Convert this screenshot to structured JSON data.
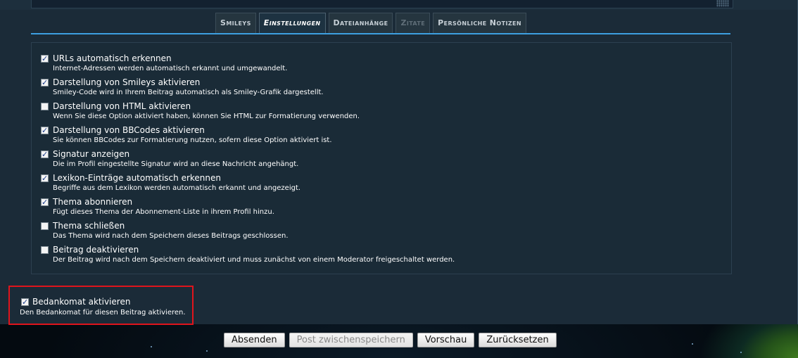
{
  "tabs": [
    {
      "label": "Smileys",
      "state": "normal"
    },
    {
      "label": "Einstellungen",
      "state": "active"
    },
    {
      "label": "Dateianhänge",
      "state": "normal"
    },
    {
      "label": "Zitate",
      "state": "disabled"
    },
    {
      "label": "Persönliche Notizen",
      "state": "normal"
    }
  ],
  "options": [
    {
      "label": "URLs automatisch erkennen",
      "desc": "Internet-Adressen werden automatisch erkannt und umgewandelt.",
      "checked": true
    },
    {
      "label": "Darstellung von Smileys aktivieren",
      "desc": "Smiley-Code wird in Ihrem Beitrag automatisch als Smiley-Grafik dargestellt.",
      "checked": true
    },
    {
      "label": "Darstellung von HTML aktivieren",
      "desc": "Wenn Sie diese Option aktiviert haben, können Sie HTML zur Formatierung verwenden.",
      "checked": false
    },
    {
      "label": "Darstellung von BBCodes aktivieren",
      "desc": "Sie können BBCodes zur Formatierung nutzen, sofern diese Option aktiviert ist.",
      "checked": true
    },
    {
      "label": "Signatur anzeigen",
      "desc": "Die im Profil eingestellte Signatur wird an diese Nachricht angehängt.",
      "checked": true
    },
    {
      "label": "Lexikon-Einträge automatisch erkennen",
      "desc": "Begriffe aus dem Lexikon werden automatisch erkannt und angezeigt.",
      "checked": true
    },
    {
      "label": "Thema abonnieren",
      "desc": "Fügt dieses Thema der Abonnement-Liste in ihrem Profil hinzu.",
      "checked": true
    },
    {
      "label": "Thema schließen",
      "desc": "Das Thema wird nach dem Speichern dieses Beitrags geschlossen.",
      "checked": false
    },
    {
      "label": "Beitrag deaktivieren",
      "desc": "Der Beitrag wird nach dem Speichern deaktiviert und muss zunächst von einem Moderator freigeschaltet werden.",
      "checked": false
    }
  ],
  "bedankomat": {
    "label": "Bedankomat aktivieren",
    "desc": "Den Bedankomat für diesen Beitrag aktivieren.",
    "checked": true
  },
  "buttons": {
    "submit": "Absenden",
    "draft": "Post zwischenspeichern",
    "preview": "Vorschau",
    "reset": "Zurücksetzen"
  },
  "colors": {
    "tab_underline": "#3d9fe0",
    "highlight_border": "#e0141c",
    "panel_bg": "#1a2b37"
  }
}
